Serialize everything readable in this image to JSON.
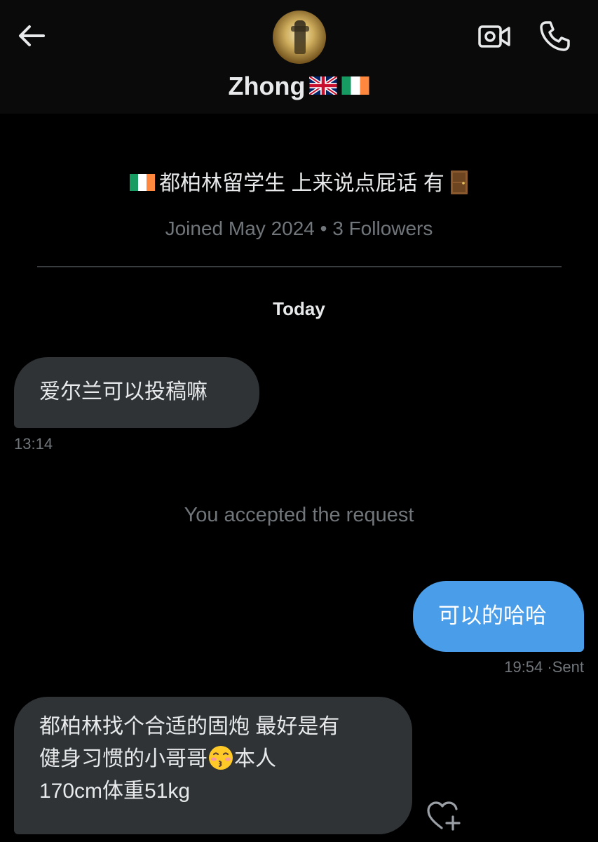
{
  "header": {
    "contact_name": "Zhong",
    "flags": [
      "united-kingdom-flag",
      "ireland-flag"
    ],
    "back_icon": "arrow-left-icon",
    "video_icon": "video-camera-icon",
    "phone_icon": "phone-icon"
  },
  "profile": {
    "bio_text": "都柏林留学生 上来说点屁话 有",
    "bio_icons": [
      "ireland-flag",
      "door-icon"
    ],
    "joined": "Joined May 2024 • 3 Followers"
  },
  "conversation": {
    "date_label": "Today",
    "messages": [
      {
        "direction": "incoming",
        "text": "爱尔兰可以投稿嘛",
        "time": "13:14"
      },
      {
        "type": "system",
        "text": "You accepted the request"
      },
      {
        "direction": "outgoing",
        "text": "可以的哈哈",
        "time": "19:54",
        "status": "·Sent"
      },
      {
        "direction": "incoming",
        "line1": "都柏林找个合适的固炮 最好是有",
        "line2_a": "健身习惯的小哥哥",
        "line2_b": "本人",
        "line3": "170cm体重51kg",
        "emoji": "kissing-face-icon"
      }
    ],
    "reaction_icon": "heart-plus-icon"
  },
  "colors": {
    "background": "#000000",
    "header": "#0a0a0a",
    "incoming_bubble": "#2f3336",
    "outgoing_bubble": "#4a9de9",
    "muted_text": "#71767b",
    "primary_text": "#e7e9ea"
  }
}
